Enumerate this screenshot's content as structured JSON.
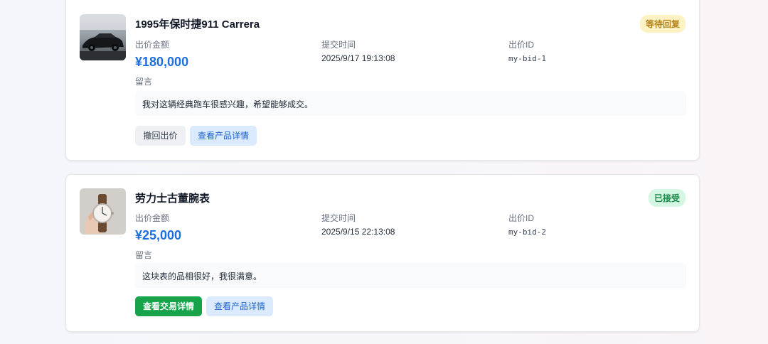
{
  "bids": [
    {
      "title": "1995年保时捷911 Carrera",
      "status": "等待回复",
      "amount_label": "出价金额",
      "amount": "¥180,000",
      "time_label": "提交时间",
      "time": "2025/9/17 19:13:08",
      "id_label": "出价ID",
      "id": "my-bid-1",
      "message_label": "留言",
      "message": "我对这辆经典跑车很感兴趣，希望能够成交。",
      "buttons": [
        "撤回出价",
        "查看产品详情"
      ],
      "image": "porsche-car-photo"
    },
    {
      "title": "劳力士古董腕表",
      "status": "已接受",
      "amount_label": "出价金额",
      "amount": "¥25,000",
      "time_label": "提交时间",
      "time": "2025/9/15 22:13:08",
      "id_label": "出价ID",
      "id": "my-bid-2",
      "message_label": "留言",
      "message": "这块表的品相很好，我很满意。",
      "buttons": [
        "查看交易详情",
        "查看产品详情"
      ],
      "image": "watch-photo"
    }
  ],
  "colors": {
    "amount": "#1d6ee0",
    "pending_badge_bg": "#fdf2c4",
    "accepted_badge_bg": "#d5f6e2",
    "primary_green": "#16a34a"
  }
}
